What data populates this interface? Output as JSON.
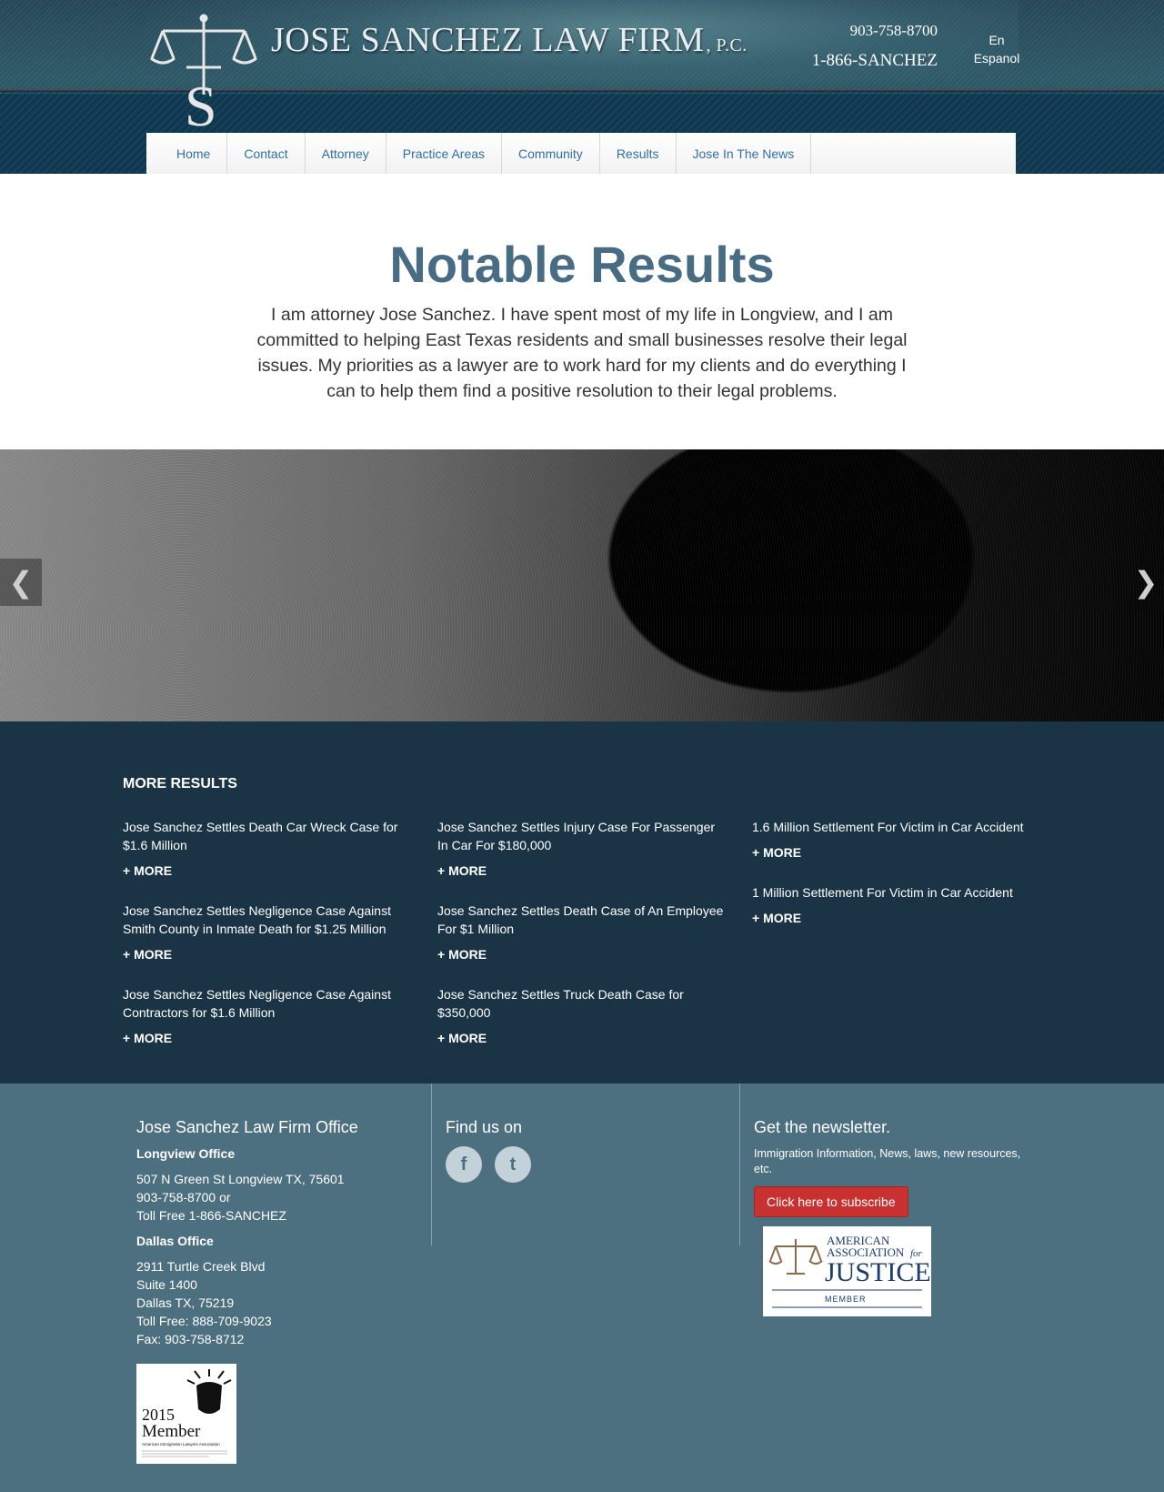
{
  "header": {
    "firm_name": "JOSE SANCHEZ LAW FIRM",
    "firm_suffix": "P.C.",
    "phone_local": "903-758-8700",
    "phone_tollfree": "1-866-SANCHEZ",
    "lang_en": "En",
    "lang_es": "Espanol"
  },
  "nav": {
    "items": [
      "Home",
      "Contact",
      "Attorney",
      "Practice Areas",
      "Community",
      "Results",
      "Jose In The News"
    ]
  },
  "main": {
    "title": "Notable Results",
    "intro": "I am attorney Jose Sanchez. I have spent most of my life in Longview, and I am committed to helping East Texas residents and small businesses resolve their legal issues. My priorities as a lawyer are to work hard for my clients and do everything I can to help them find a positive resolution to their legal problems."
  },
  "slider": {
    "prev_glyph": "❮",
    "next_glyph": "❯"
  },
  "results": {
    "heading": "MORE RESULTS",
    "more_label": "+ MORE",
    "columns": [
      [
        "Jose Sanchez Settles Death Car Wreck Case for $1.6 Million",
        "Jose Sanchez Settles Negligence Case Against Smith County in Inmate Death for $1.25 Million",
        "Jose Sanchez Settles Negligence Case Against Contractors for $1.6 Million"
      ],
      [
        "Jose Sanchez Settles Injury Case For Passenger In Car For $180,000",
        "Jose Sanchez Settles Death Case of An Employee For $1 Million",
        "Jose Sanchez Settles Truck Death Case for $350,000"
      ],
      [
        "1.6 Million Settlement For Victim in Car Accident",
        "1 Million Settlement For Victim in Car Accident"
      ]
    ]
  },
  "footer": {
    "office_heading": "Jose Sanchez Law Firm Office",
    "longview": {
      "title": "Longview Office",
      "lines": [
        "507 N Green St Longview TX, 75601",
        "903-758-8700 or",
        "Toll Free 1-866-SANCHEZ"
      ]
    },
    "dallas": {
      "title": "Dallas Office",
      "lines": [
        "2911 Turtle Creek Blvd",
        "Suite 1400",
        "Dallas TX, 75219",
        "Toll Free: 888-709-9023",
        "Fax: 903-758-8712"
      ]
    },
    "member_badge": {
      "year": "2015",
      "label": "Member",
      "org": "American Immigration Lawyers Association"
    },
    "social_heading": "Find us on",
    "social": {
      "facebook_glyph": "f",
      "twitter_glyph": "t"
    },
    "newsletter_heading": "Get the newsletter.",
    "newsletter_text": "Immigration Information, News, laws, new resources, etc.",
    "subscribe_label": "Click here to subscribe",
    "aaj": {
      "line1": "AMERICAN",
      "line2": "ASSOCIATION",
      "line2b": "for",
      "line3": "JUSTICE",
      "line4": "MEMBER"
    }
  },
  "colors": {
    "title": "#476c84",
    "nav_link": "#2f6fa6",
    "results_bg": "#1a3446",
    "footer_bg": "#4d7080",
    "subscribe": "#c93131"
  }
}
